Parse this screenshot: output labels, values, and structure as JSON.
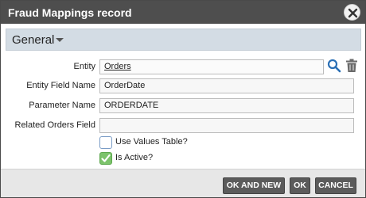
{
  "window": {
    "title": "Fraud Mappings record"
  },
  "section": {
    "title": "General"
  },
  "fields": {
    "entity": {
      "label": "Entity",
      "value": "Orders"
    },
    "entity_field_name": {
      "label": "Entity Field Name",
      "value": "OrderDate"
    },
    "parameter_name": {
      "label": "Parameter Name",
      "value": "ORDERDATE"
    },
    "related_orders_field": {
      "label": "Related Orders Field",
      "value": ""
    }
  },
  "checkboxes": {
    "use_values_table": {
      "label": "Use Values Table?",
      "checked": false
    },
    "is_active": {
      "label": "Is Active?",
      "checked": true
    }
  },
  "buttons": {
    "ok_and_new": "OK AND NEW",
    "ok": "OK",
    "cancel": "CANCEL"
  },
  "icons": {
    "close": "close-icon",
    "search": "search-icon",
    "delete": "trash-icon",
    "section_toggle": "caret-down-icon",
    "check": "check-icon"
  },
  "colors": {
    "titlebar": "#4e4e4e",
    "section_header": "#d3dce4",
    "button": "#5b5b5b",
    "search_icon": "#2a6fb5",
    "checkbox_checked": "#7cc36b"
  }
}
